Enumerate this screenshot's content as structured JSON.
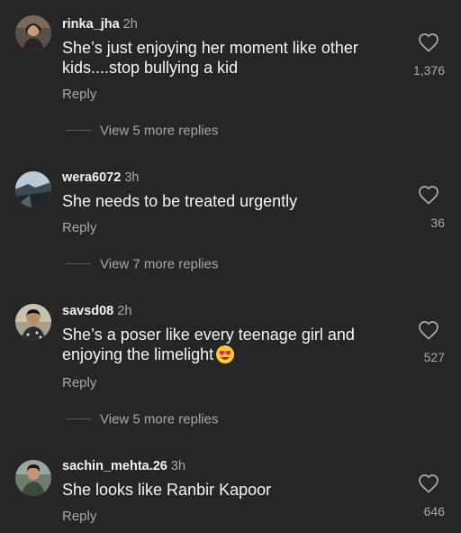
{
  "comments": [
    {
      "username": "rinka_jha",
      "time": "2h",
      "text": "She’s just enjoying her moment like other kids....stop bullying a kid",
      "reply_label": "Reply",
      "likes": "1,376",
      "view_more": "View 5 more replies"
    },
    {
      "username": "wera6072",
      "time": "3h",
      "text": "She needs to be treated urgently",
      "reply_label": "Reply",
      "likes": "36",
      "view_more": "View 7 more replies"
    },
    {
      "username": "savsd08",
      "time": "2h",
      "text": "She’s a poser like every teenage girl and enjoying the limelight",
      "emoji": "heart-eyes-emoji",
      "reply_label": "Reply",
      "likes": "527",
      "view_more": "View 5 more replies"
    },
    {
      "username": "sachin_mehta.26",
      "time": "3h",
      "text": "She looks like Ranbir Kapoor",
      "reply_label": "Reply",
      "likes": "646"
    }
  ],
  "icons": {
    "like": "heart-outline-icon"
  },
  "colors": {
    "background": "#262626",
    "primary_text": "#f5f5f5",
    "secondary_text": "#a8a8a8"
  }
}
